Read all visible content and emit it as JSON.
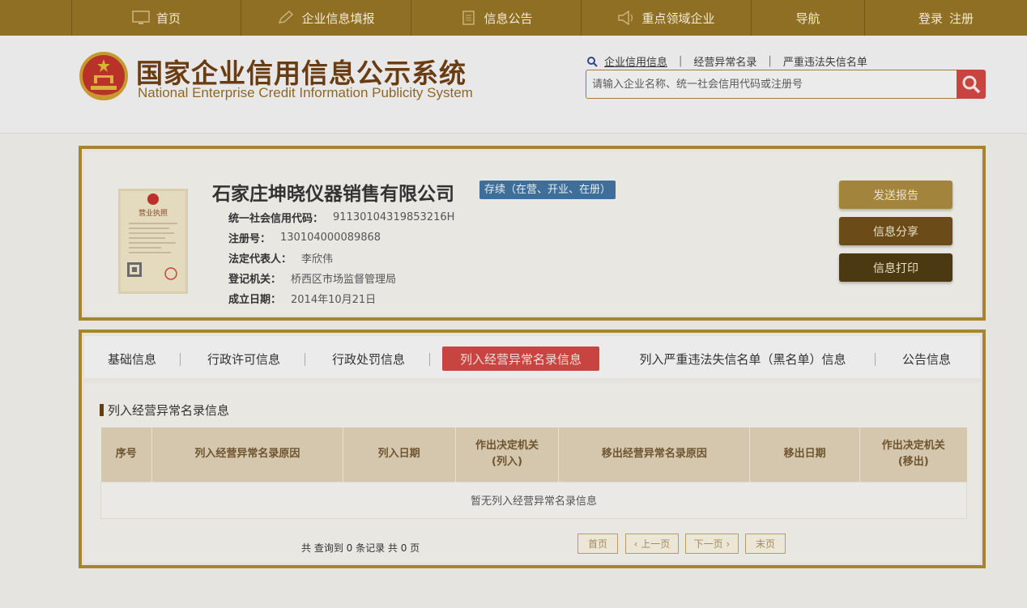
{
  "nav": {
    "home": "首页",
    "fill": "企业信息填报",
    "notice": "信息公告",
    "key_areas": "重点领域企业",
    "guide": "导航",
    "login": "登录",
    "register": "注册"
  },
  "header": {
    "title_cn": "国家企业信用信息公示系统",
    "title_en": "National Enterprise Credit Information Publicity System",
    "search_links": [
      "企业信用信息",
      "经营异常名录",
      "严重违法失信名单"
    ],
    "search_placeholder": "请输入企业名称、统一社会信用代码或注册号"
  },
  "company": {
    "name": "石家庄坤晓仪器销售有限公司",
    "status": "存续（在营、开业、在册）",
    "license_label": "营业执照",
    "fields": [
      {
        "label": "统一社会信用代码：",
        "value": "91130104319853216H"
      },
      {
        "label": "注册号：",
        "value": "130104000089868"
      },
      {
        "label": "法定代表人：",
        "value": "李欣伟"
      },
      {
        "label": "登记机关：",
        "value": "桥西区市场监督管理局"
      },
      {
        "label": "成立日期：",
        "value": "2014年10月21日"
      }
    ],
    "buttons": {
      "report": "发送报告",
      "share": "信息分享",
      "print": "信息打印"
    }
  },
  "tabs": [
    "基础信息",
    "行政许可信息",
    "行政处罚信息",
    "列入经营异常名录信息",
    "列入严重违法失信名单（黑名单）信息",
    "公告信息"
  ],
  "active_tab": "列入经营异常名录信息",
  "section": {
    "title": "列入经营异常名录信息",
    "columns": [
      "序号",
      "列入经营异常名录原因",
      "列入日期",
      "作出决定机关",
      "(列入)",
      "移出经营异常名录原因",
      "移出日期",
      "作出决定机关",
      "(移出)"
    ],
    "empty_text": "暂无列入经营异常名录信息"
  },
  "pager": {
    "info": "共 查询到 0 条记录 共 0 页",
    "first": "首页",
    "prev": "上一页",
    "next": "下一页",
    "last": "末页"
  },
  "colors": {
    "nav_bg": "#8f6f23",
    "frame": "#a7852f",
    "accent_red": "#c74440",
    "status_blue": "#3f6f98"
  }
}
